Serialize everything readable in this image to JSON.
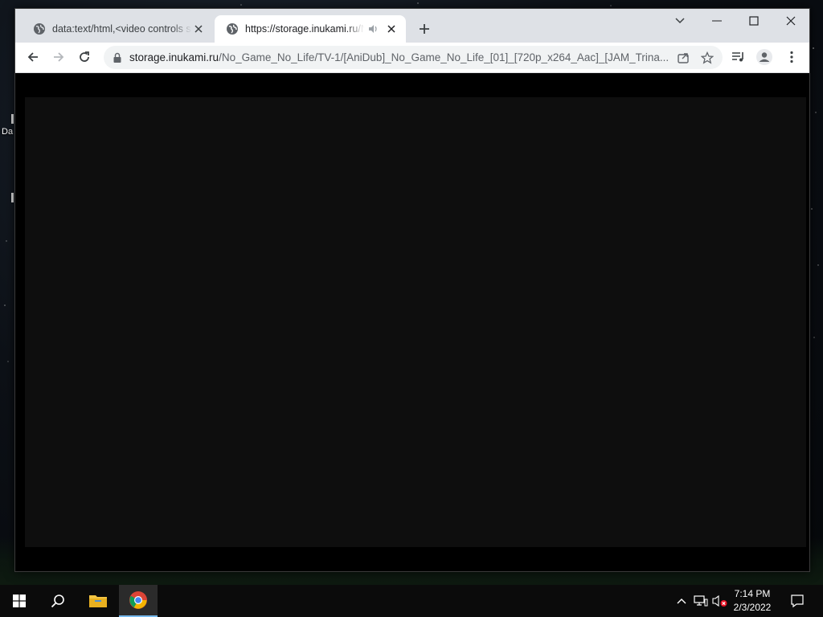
{
  "desktop": {
    "icon_label": "Da"
  },
  "browser": {
    "tabs": [
      {
        "title": "data:text/html,<video controls src=",
        "active": false,
        "icon": "globe-icon"
      },
      {
        "title": "https://storage.inukami.ru/No_Game_No_Life",
        "active": true,
        "icon": "globe-icon",
        "audio_icon": "speaker-icon"
      }
    ],
    "address": {
      "host": "storage.inukami.ru",
      "path": "/No_Game_No_Life/TV-1/[AniDub]_No_Game_No_Life_[01]_[720p_x264_Aac]_[JAM_Trina..."
    }
  },
  "taskbar": {
    "time": "7:14 PM",
    "date": "2/3/2022"
  },
  "colors": {
    "tabstrip": "#dee1e6",
    "taskbar_accent": "#76b9ed"
  }
}
